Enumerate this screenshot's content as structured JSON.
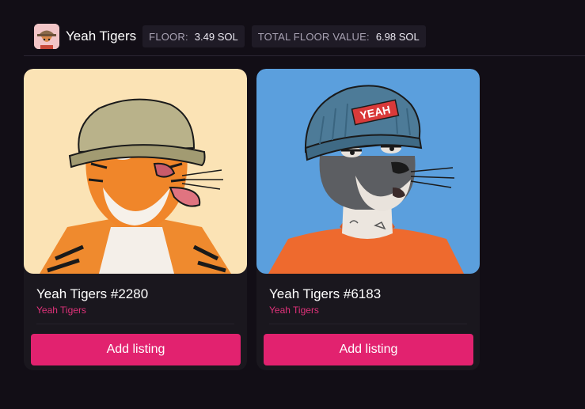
{
  "collection": {
    "name": "Yeah Tigers",
    "floor_label": "FLOOR:",
    "floor_value": "3.49 SOL",
    "total_floor_label": "TOTAL FLOOR VALUE:",
    "total_floor_value": "6.98 SOL"
  },
  "cards": [
    {
      "title": "Yeah Tigers #2280",
      "collection": "Yeah Tigers",
      "button_label": "Add listing",
      "background": "#fbe3b5"
    },
    {
      "title": "Yeah Tigers #6183",
      "collection": "Yeah Tigers",
      "button_label": "Add listing",
      "background": "#5b9fdd",
      "hat_text": "YEAH"
    }
  ],
  "colors": {
    "page_background": "#120e16",
    "accent": "#e2226f",
    "collection_link": "#e0327a"
  }
}
